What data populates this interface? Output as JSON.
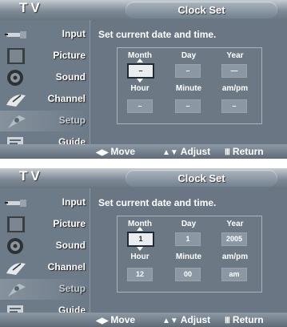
{
  "screens": [
    {
      "tv_label": "TV",
      "title": "Clock Set",
      "sidebar": {
        "items": [
          {
            "label": "Input",
            "icon": "input-plug-icon"
          },
          {
            "label": "Picture",
            "icon": "picture-icon"
          },
          {
            "label": "Sound",
            "icon": "speaker-icon"
          },
          {
            "label": "Channel",
            "icon": "satellite-dish-icon"
          },
          {
            "label": "Setup",
            "icon": "setup-icon",
            "active": true
          },
          {
            "label": "Guide",
            "icon": "guide-icon"
          }
        ]
      },
      "instruction": "Set current date and time.",
      "headers": {
        "month": "Month",
        "day": "Day",
        "year": "Year",
        "hour": "Hour",
        "minute": "Minute",
        "ampm": "am/pm"
      },
      "values": {
        "month": "–",
        "day": "–",
        "year": "—",
        "hour": "–",
        "minute": "–",
        "ampm": "–"
      },
      "selected_field": "month",
      "footer": {
        "move": "Move",
        "adjust": "Adjust",
        "return": "Return"
      }
    },
    {
      "tv_label": "TV",
      "title": "Clock Set",
      "sidebar": {
        "items": [
          {
            "label": "Input",
            "icon": "input-plug-icon"
          },
          {
            "label": "Picture",
            "icon": "picture-icon"
          },
          {
            "label": "Sound",
            "icon": "speaker-icon"
          },
          {
            "label": "Channel",
            "icon": "satellite-dish-icon"
          },
          {
            "label": "Setup",
            "icon": "setup-icon",
            "active": true
          },
          {
            "label": "Guide",
            "icon": "guide-icon"
          }
        ]
      },
      "instruction": "Set current date and time.",
      "headers": {
        "month": "Month",
        "day": "Day",
        "year": "Year",
        "hour": "Hour",
        "minute": "Minute",
        "ampm": "am/pm"
      },
      "values": {
        "month": "1",
        "day": "1",
        "year": "2005",
        "hour": "12",
        "minute": "00",
        "ampm": "am"
      },
      "selected_field": "month",
      "footer": {
        "move": "Move",
        "adjust": "Adjust",
        "return": "Return"
      }
    }
  ],
  "colors": {
    "panel": "#6d7a87",
    "selected_field": "#e9edf0",
    "text": "#ffffff"
  }
}
